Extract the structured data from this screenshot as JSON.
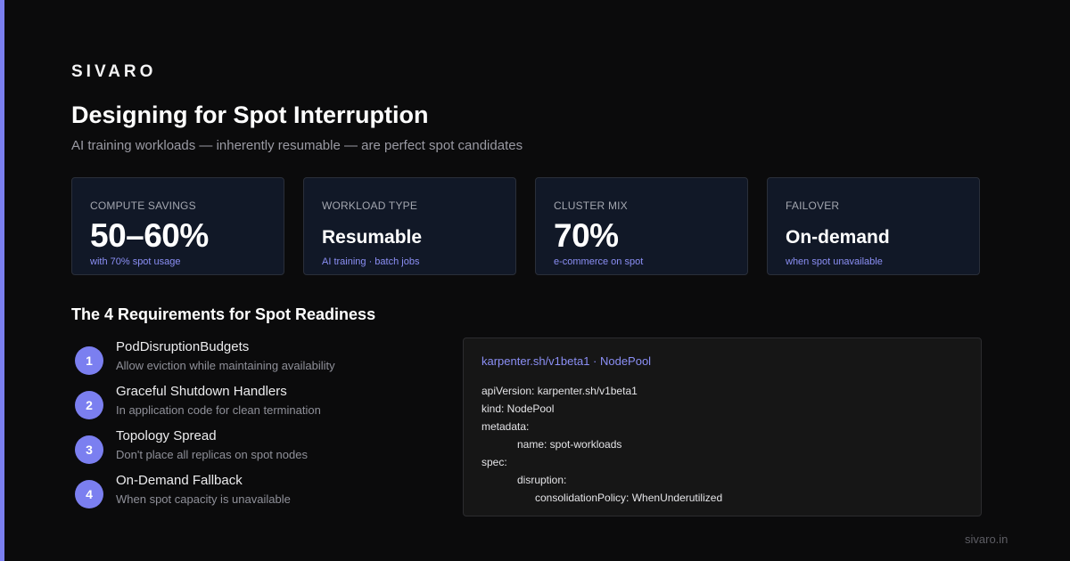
{
  "brand": "SIVARO",
  "title": "Designing for Spot Interruption",
  "subtitle": "AI training workloads — inherently resumable — are perfect spot candidates",
  "colors": {
    "accent": "#7b7ff0",
    "background": "#0b0b0c",
    "card": "#111827",
    "link": "#8b8ff5"
  },
  "stats": [
    {
      "label": "COMPUTE SAVINGS",
      "value": "50–60%",
      "sub": "with 70% spot usage"
    },
    {
      "label": "WORKLOAD TYPE",
      "value": "Resumable",
      "sub": "AI training · batch jobs"
    },
    {
      "label": "CLUSTER MIX",
      "value": "70%",
      "sub": "e-commerce on spot"
    },
    {
      "label": "FAILOVER",
      "value": "On-demand",
      "sub": "when spot unavailable"
    }
  ],
  "requirements": {
    "title": "The 4 Requirements for Spot Readiness",
    "items": [
      {
        "num": "1",
        "title": "PodDisruptionBudgets",
        "desc": "Allow eviction while maintaining availability"
      },
      {
        "num": "2",
        "title": "Graceful Shutdown Handlers",
        "desc": "In application code for clean termination"
      },
      {
        "num": "3",
        "title": "Topology Spread",
        "desc": "Don't place all replicas on spot nodes"
      },
      {
        "num": "4",
        "title": "On-Demand Fallback",
        "desc": "When spot capacity is unavailable"
      }
    ]
  },
  "code": {
    "header": "karpenter.sh/v1beta1 · NodePool",
    "lines": [
      "apiVersion: karpenter.sh/v1beta1",
      "kind: NodePool",
      "metadata:",
      "name: spot-workloads",
      "spec:",
      "disruption:",
      "consolidationPolicy: WhenUnderutilized"
    ]
  },
  "footer": "sivaro.in"
}
